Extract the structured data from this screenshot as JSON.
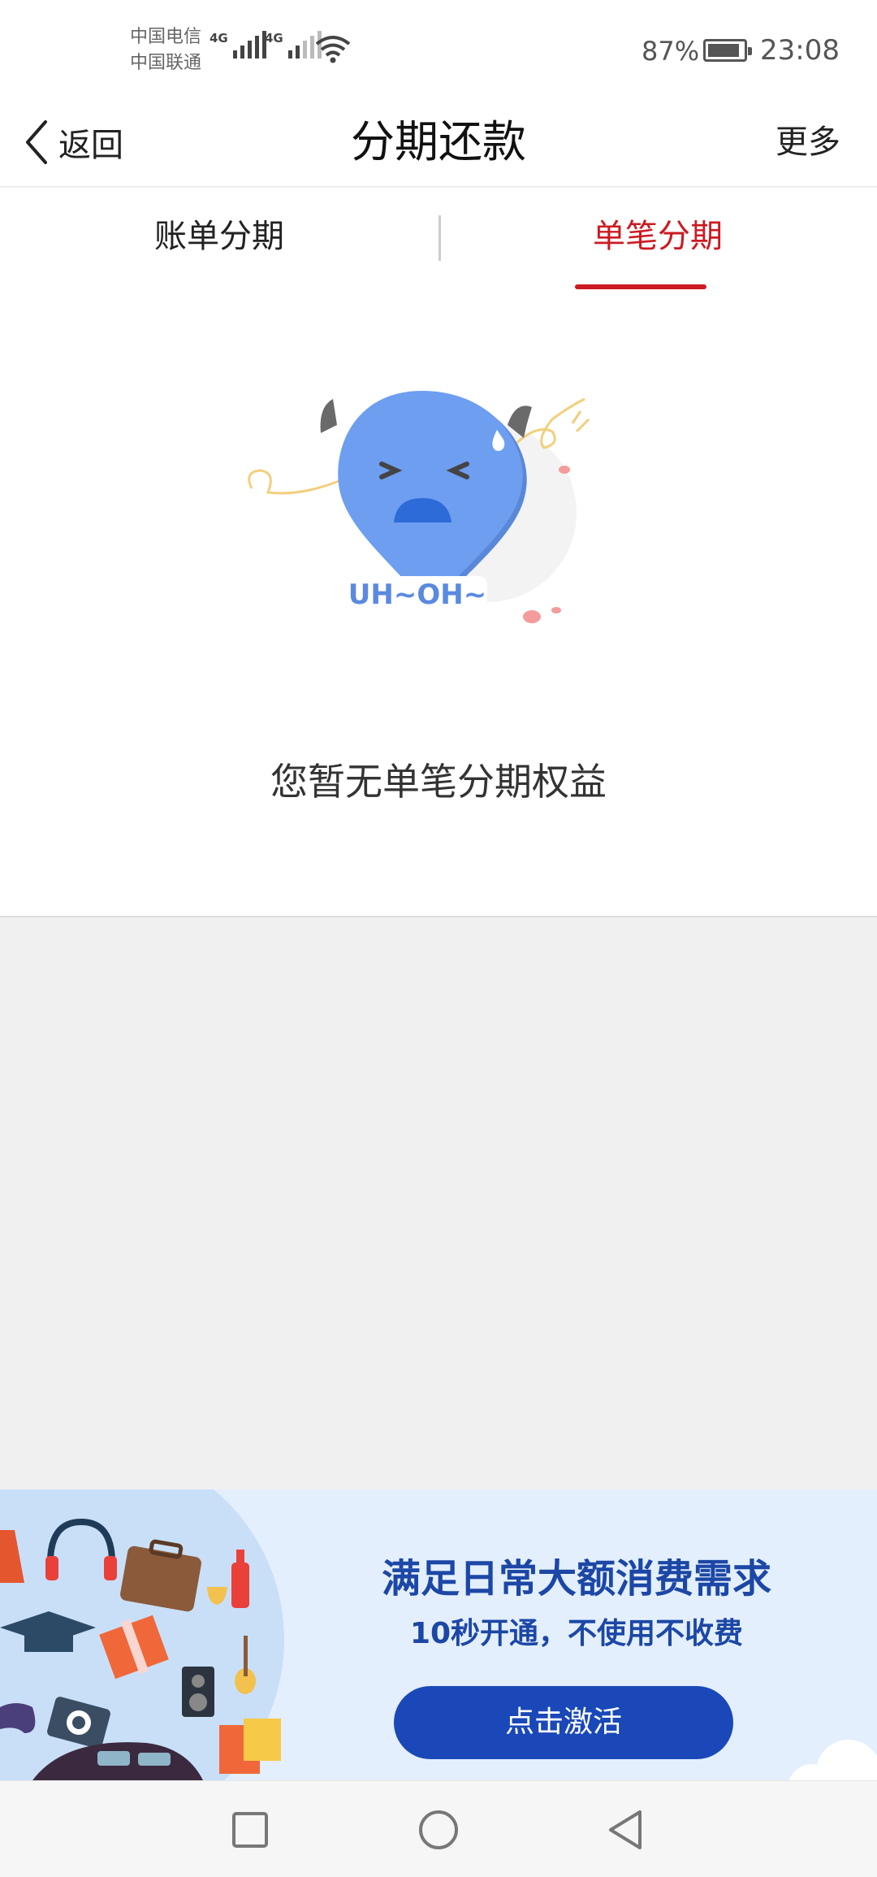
{
  "status_bar": {
    "carrier_1": "中国电信",
    "carrier_2": "中国联通",
    "network_1": "4G",
    "network_2": "4G",
    "battery_percent": "87%",
    "battery_level": 0.87,
    "time": "23:08",
    "icons": [
      "signal-icon",
      "wifi-icon",
      "battery-icon"
    ]
  },
  "navbar": {
    "back_label": "返回",
    "title": "分期还款",
    "more_label": "更多"
  },
  "tabs": [
    {
      "label": "账单分期",
      "active": false
    },
    {
      "label": "单笔分期",
      "active": true
    }
  ],
  "empty_state": {
    "badge_text": "UH~OH~",
    "message": "您暂无单笔分期权益"
  },
  "banner": {
    "title": "满足日常大额消费需求",
    "subtitle": "10秒开通，不使用不收费",
    "button_label": "点击激活"
  },
  "system_nav": {
    "icons": [
      "recents-square-icon",
      "home-circle-icon",
      "back-triangle-icon"
    ]
  },
  "colors": {
    "accent_red": "#cc1a22",
    "banner_blue": "#1c47a6",
    "button_blue": "#1a48b8",
    "mascot_blue": "#6d9ef0"
  }
}
